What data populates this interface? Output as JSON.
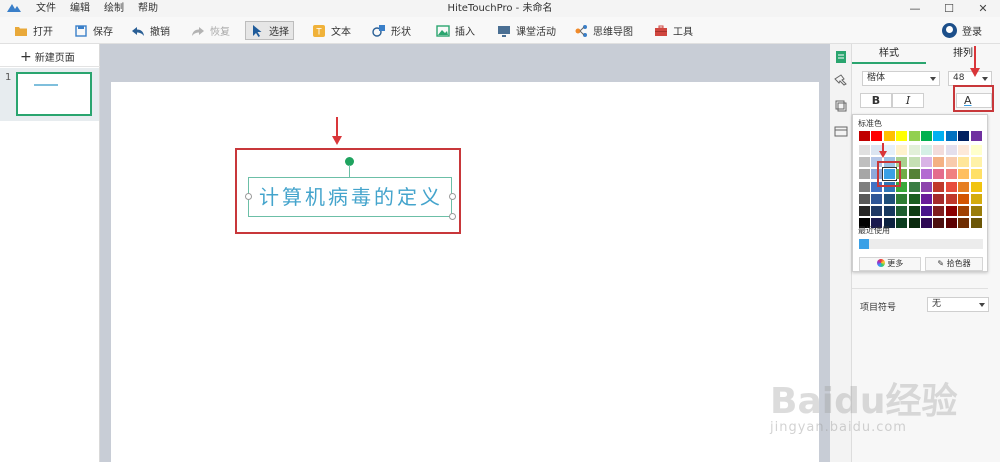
{
  "titlebar": {
    "menu": [
      "文件",
      "编辑",
      "绘制",
      "帮助"
    ],
    "title": "HiteTouchPro - 未命名",
    "min": "—",
    "max": "☐",
    "close": "✕"
  },
  "toolbar": {
    "open": "打开",
    "save": "保存",
    "undo": "撤销",
    "redo": "恢复",
    "select": "选择",
    "text": "文本",
    "shape": "形状",
    "insert": "插入",
    "classroom": "课堂活动",
    "mindmap": "思维导图",
    "tools": "工具",
    "login": "登录"
  },
  "left": {
    "new_page": "新建页面",
    "slide_number": "1"
  },
  "canvas": {
    "textbox_text": "计算机病毒的定义"
  },
  "right": {
    "tab_style": "样式",
    "tab_arrange": "排列",
    "font_name": "楷体",
    "font_size": "48",
    "bold": "B",
    "italic": "I",
    "font_color_letter": "A"
  },
  "color_popup": {
    "standard_label": "标准色",
    "recent_label": "最近使用",
    "more_label": "更多",
    "picker_label": "拾色器",
    "selected_color": "#3aa0e6"
  },
  "bullet": {
    "label": "项目符号",
    "value": "无"
  },
  "watermark": {
    "brand": "Baidu经验",
    "url": "jingyan.baidu.com"
  },
  "colors": {
    "accent": "#2aa56f",
    "annotation_red": "#c8373a",
    "text_blue": "#44a4cc"
  }
}
